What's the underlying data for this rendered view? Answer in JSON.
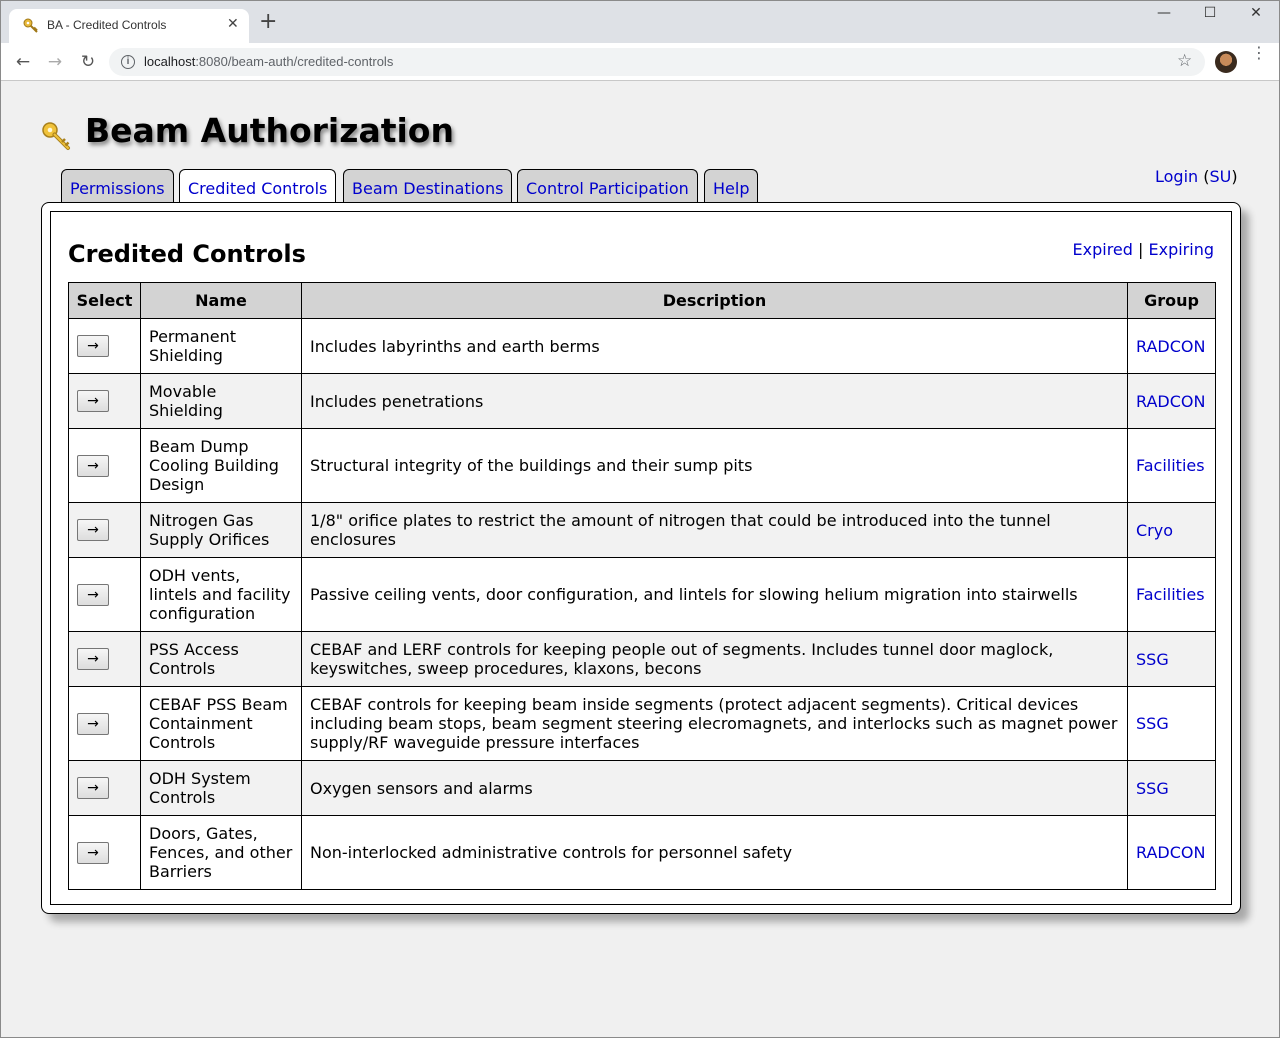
{
  "browser": {
    "tab_title": "BA - Credited Controls",
    "tab_close": "✕",
    "new_tab": "+",
    "window_controls": {
      "minimize": "—",
      "maximize": "☐",
      "close": "✕"
    },
    "nav": {
      "back": "←",
      "forward": "→",
      "reload": "↻"
    },
    "url_host": "localhost",
    "url_rest": ":8080/beam-auth/credited-controls",
    "star": "☆",
    "menu": "⋮"
  },
  "app": {
    "title": "Beam Authorization",
    "icon": "key-icon"
  },
  "nav_tabs": [
    {
      "label": "Permissions",
      "active": false
    },
    {
      "label": "Credited Controls",
      "active": true
    },
    {
      "label": "Beam Destinations",
      "active": false
    },
    {
      "label": "Control Participation",
      "active": false
    },
    {
      "label": "Help",
      "active": false
    }
  ],
  "login": {
    "login_label": "Login",
    "su_label": "SU"
  },
  "section": {
    "title": "Credited Controls",
    "expired_link": "Expired",
    "separator": "|",
    "expiring_link": "Expiring"
  },
  "table": {
    "headers": {
      "select": "Select",
      "name": "Name",
      "description": "Description",
      "group": "Group"
    },
    "select_button": "→",
    "rows": [
      {
        "name": "Permanent Shielding",
        "description": "Includes labyrinths and earth berms",
        "group": "RADCON"
      },
      {
        "name": "Movable Shielding",
        "description": "Includes penetrations",
        "group": "RADCON"
      },
      {
        "name": "Beam Dump Cooling Building Design",
        "description": "Structural integrity of the buildings and their sump pits",
        "group": "Facilities"
      },
      {
        "name": "Nitrogen Gas Supply Orifices",
        "description": "1/8\" orifice plates to restrict the amount of nitrogen that could be introduced into the tunnel enclosures",
        "group": "Cryo"
      },
      {
        "name": "ODH vents, lintels and facility configuration",
        "description": "Passive ceiling vents, door configuration, and lintels for slowing helium migration into stairwells",
        "group": "Facilities"
      },
      {
        "name": "PSS Access Controls",
        "description": "CEBAF and LERF controls for keeping people out of segments. Includes tunnel door maglock, keyswitches, sweep procedures, klaxons, becons",
        "group": "SSG"
      },
      {
        "name": "CEBAF PSS Beam Containment Controls",
        "description": "CEBAF controls for keeping beam inside segments (protect adjacent segments). Critical devices including beam stops, beam segment steering elecromagnets, and interlocks such as magnet power supply/RF waveguide pressure interfaces",
        "group": "SSG"
      },
      {
        "name": "ODH System Controls",
        "description": "Oxygen sensors and alarms",
        "group": "SSG"
      },
      {
        "name": "Doors, Gates, Fences, and other Barriers",
        "description": "Non-interlocked administrative controls for personnel safety",
        "group": "RADCON"
      }
    ]
  },
  "colors": {
    "link": "#0000cc",
    "header_bg": "#d3d3d3",
    "alt_row": "#f2f2f2",
    "page_bg": "#f0f0f0"
  }
}
